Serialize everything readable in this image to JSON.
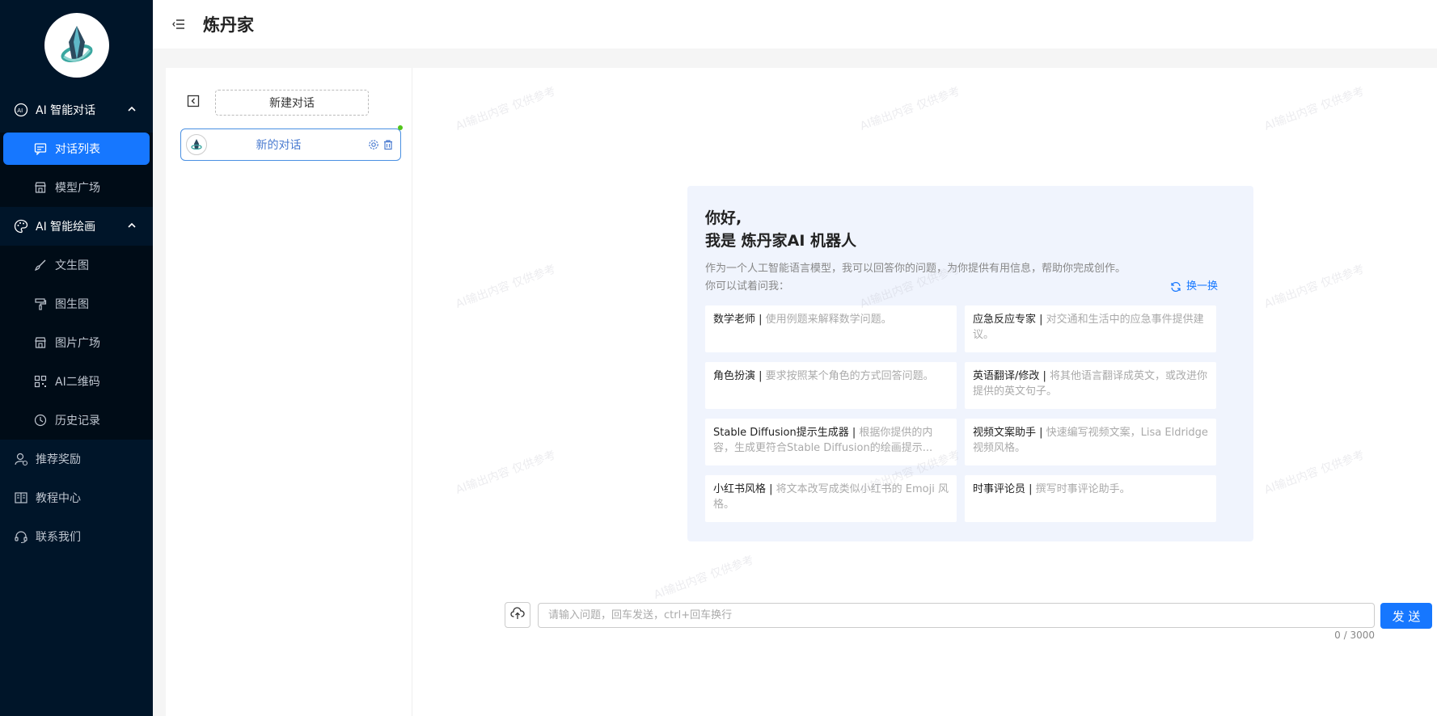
{
  "app": {
    "title": "炼丹家"
  },
  "sidebar": {
    "groups": [
      {
        "label": "AI 智能对话",
        "icon": "ai-chat-icon",
        "items": [
          {
            "label": "对话列表",
            "icon": "message-icon",
            "active": true
          },
          {
            "label": "模型广场",
            "icon": "store-icon"
          }
        ]
      },
      {
        "label": "AI 智能绘画",
        "icon": "palette-icon",
        "items": [
          {
            "label": "文生图",
            "icon": "brush-icon"
          },
          {
            "label": "图生图",
            "icon": "roller-icon"
          },
          {
            "label": "图片广场",
            "icon": "store-icon"
          },
          {
            "label": "AI二维码",
            "icon": "qrcode-icon"
          },
          {
            "label": "历史记录",
            "icon": "clock-icon"
          }
        ]
      }
    ],
    "top_items": [
      {
        "label": "推荐奖励",
        "icon": "user-reward-icon"
      },
      {
        "label": "教程中心",
        "icon": "book-icon"
      },
      {
        "label": "联系我们",
        "icon": "headset-icon"
      }
    ]
  },
  "conversations": {
    "new_button": "新建对话",
    "items": [
      {
        "name": "新的对话"
      }
    ]
  },
  "welcome": {
    "greeting_line1": "你好,",
    "greeting_line2": "我是 炼丹家AI 机器人",
    "description": "作为一个人工智能语言模型，我可以回答你的问题，为你提供有用信息，帮助你完成创作。",
    "try_label": "你可以试着问我：",
    "refresh_label": "换一换",
    "prompts": [
      {
        "title": "数学老师",
        "desc": "使用例题来解释数学问题。"
      },
      {
        "title": "应急反应专家",
        "desc": "对交通和生活中的应急事件提供建议。"
      },
      {
        "title": "角色扮演",
        "desc": "要求按照某个角色的方式回答问题。"
      },
      {
        "title": "英语翻译/修改",
        "desc": "将其他语言翻译成英文，或改进你提供的英文句子。"
      },
      {
        "title": "Stable Diffusion提示生成器",
        "desc": "根据你提供的内容，生成更符合Stable Diffusion的绘画提示..."
      },
      {
        "title": "视频文案助手",
        "desc": "快速编写视频文案，Lisa Eldridge视频风格。"
      },
      {
        "title": "小红书风格",
        "desc": "将文本改写成类似小红书的 Emoji 风格。"
      },
      {
        "title": "时事评论员",
        "desc": "撰写时事评论助手。"
      }
    ]
  },
  "input": {
    "placeholder": "请输入问题，回车发送，ctrl+回车换行",
    "value": "",
    "send_label": "发 送",
    "counter": "0 / 3000"
  },
  "watermark": "AI输出内容 仅供参考",
  "colors": {
    "sidebar_bg": "#001529",
    "accent": "#1677ff",
    "card_bg": "#f0f4fd"
  }
}
